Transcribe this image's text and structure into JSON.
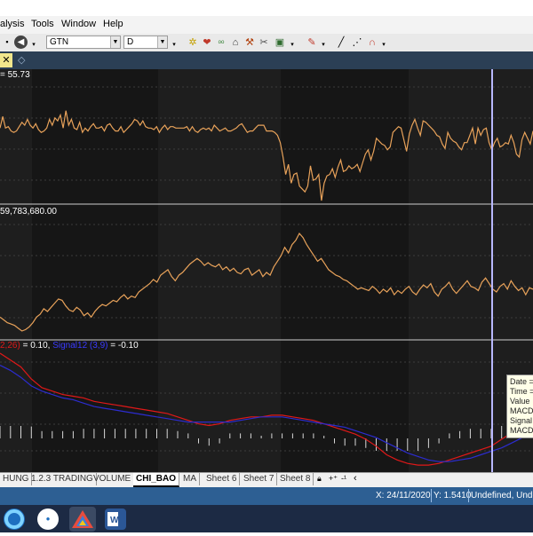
{
  "menu": {
    "items": [
      "alysis",
      "Tools",
      "Window",
      "Help"
    ]
  },
  "toolbar": {
    "symbol": "GTN",
    "period": "D"
  },
  "panels": {
    "price_label": "= 55.73",
    "volume_label": "59,783,680.00",
    "macd_label_red": "2,26)",
    "macd_value": "= 0.10,",
    "signal_label": "Signal12 (3,9)",
    "signal_value": "= -0.10"
  },
  "tooltip": {
    "lines": [
      "Date =",
      "Time =",
      "Value",
      "MACD",
      "Signal",
      "MACD"
    ]
  },
  "sheet_tabs": [
    "HUNG",
    "1.2.3 TRADING",
    "VOLUME",
    "CHI_BAO",
    "MA",
    "Sheet 6",
    "Sheet 7",
    "Sheet 8"
  ],
  "active_sheet": "CHI_BAO",
  "status": {
    "x": "X: 24/11/2020",
    "y": "Y: 1.5410",
    "text": "Undefined, Unde"
  },
  "colors": {
    "price_line": "#e8a25a",
    "macd_red": "#e01818",
    "signal_blue": "#2c2ccf",
    "cursor": "#b8b8ff",
    "chart_bg": "#161616",
    "status_bg": "#2d5f93"
  },
  "chart_data": [
    {
      "type": "line",
      "series": [
        {
          "values": [
            150,
            158,
            150,
            151,
            148,
            147,
            148,
            151,
            154,
            152,
            156,
            152,
            150,
            153,
            149,
            147,
            148,
            150,
            156,
            152,
            157,
            155,
            159,
            150,
            162,
            152,
            156,
            150,
            149,
            154,
            147,
            150,
            148,
            151,
            153,
            150,
            150,
            151,
            148,
            152,
            153,
            150,
            148,
            148,
            151,
            147,
            149,
            151,
            153,
            156,
            155,
            152,
            155,
            151,
            150,
            150,
            149,
            151,
            147,
            150,
            152,
            149,
            151,
            151,
            150,
            150,
            150,
            150,
            151,
            148,
            151,
            148,
            147,
            149,
            150,
            149,
            150,
            148,
            152,
            150,
            148,
            149,
            150,
            148,
            148,
            149,
            150,
            152,
            153,
            150,
            147,
            148,
            148,
            150,
            152,
            152,
            152,
            148,
            148,
            148,
            147,
            145,
            140,
            130,
            118,
            125,
            112,
            118,
            119,
            110,
            108,
            106,
            110,
            124,
            114,
            115,
            118,
            100,
            112,
            117,
            118,
            122,
            116,
            123,
            128,
            120,
            121,
            124,
            122,
            123,
            125,
            120,
            126,
            132,
            135,
            128,
            134,
            143,
            141,
            139,
            138,
            135,
            137,
            147,
            149,
            151,
            150,
            142,
            134,
            146,
            152,
            156,
            150,
            145,
            155,
            154,
            152,
            150,
            148,
            145,
            144,
            139,
            136,
            147,
            143,
            141,
            140,
            137,
            135,
            140,
            140,
            145,
            150,
            139,
            150,
            145,
            149,
            150,
            140,
            135,
            140,
            143,
            137,
            138,
            140,
            139,
            145,
            140,
            132,
            130,
            142,
            147,
            143,
            139,
            148
          ]
        }
      ]
    },
    {
      "type": "line",
      "series": [
        {
          "values": [
            20,
            18,
            16,
            15,
            14,
            12,
            10,
            11,
            13,
            16,
            20,
            22,
            26,
            24,
            27,
            30,
            33,
            32,
            28,
            25,
            24,
            27,
            25,
            21,
            23,
            20,
            24,
            27,
            29,
            28,
            30,
            32,
            31,
            34,
            36,
            33,
            35,
            34,
            38,
            40,
            42,
            44,
            47,
            45,
            50,
            52,
            54,
            49,
            46,
            50,
            52,
            55,
            58,
            60,
            62,
            60,
            57,
            59,
            57,
            56,
            58,
            54,
            56,
            53,
            55,
            52,
            51,
            54,
            55,
            50,
            52,
            54,
            49,
            52,
            50,
            56,
            60,
            64,
            70,
            66,
            72,
            75,
            80,
            77,
            72,
            68,
            64,
            60,
            62,
            58,
            54,
            52,
            50,
            49,
            47,
            46,
            44,
            42,
            40,
            41,
            40,
            39,
            42,
            40,
            37,
            40,
            38,
            41,
            36,
            39,
            37,
            40,
            42,
            38,
            36,
            40,
            43,
            41,
            44,
            38,
            35,
            40,
            42,
            45,
            40,
            37,
            40,
            43,
            46,
            42,
            41,
            39,
            45,
            48,
            44,
            40,
            38,
            42,
            44,
            40,
            46,
            42,
            39,
            41,
            36,
            41,
            40
          ]
        }
      ]
    },
    {
      "type": "line",
      "series": [
        {
          "name": "",
          "values": [
            0.12,
            0.08,
            0.04,
            -0.03,
            -0.08,
            -0.1,
            -0.12,
            -0.13,
            -0.14,
            -0.16,
            -0.17,
            -0.18,
            -0.19,
            -0.2,
            -0.21,
            -0.22,
            -0.23,
            -0.25,
            -0.27,
            -0.29,
            -0.3,
            -0.29,
            -0.27,
            -0.26,
            -0.25,
            -0.25,
            -0.24,
            -0.24,
            -0.25,
            -0.26,
            -0.27,
            -0.29,
            -0.31,
            -0.33,
            -0.35,
            -0.38,
            -0.42,
            -0.47,
            -0.5,
            -0.52,
            -0.53,
            -0.53,
            -0.52,
            -0.5,
            -0.48,
            -0.46,
            -0.44,
            -0.42,
            -0.38,
            -0.34,
            -0.3,
            -0.25
          ]
        },
        {
          "name": "Signal12 (3,9)",
          "values": [
            0.05,
            0.02,
            -0.02,
            -0.07,
            -0.1,
            -0.12,
            -0.14,
            -0.15,
            -0.17,
            -0.19,
            -0.2,
            -0.21,
            -0.22,
            -0.23,
            -0.24,
            -0.25,
            -0.26,
            -0.27,
            -0.28,
            -0.28,
            -0.28,
            -0.28,
            -0.28,
            -0.27,
            -0.26,
            -0.25,
            -0.25,
            -0.25,
            -0.26,
            -0.27,
            -0.28,
            -0.29,
            -0.3,
            -0.31,
            -0.33,
            -0.35,
            -0.37,
            -0.4,
            -0.43,
            -0.46,
            -0.48,
            -0.5,
            -0.51,
            -0.51,
            -0.5,
            -0.49,
            -0.47,
            -0.45,
            -0.43,
            -0.4,
            -0.37,
            -0.34
          ]
        }
      ]
    }
  ]
}
